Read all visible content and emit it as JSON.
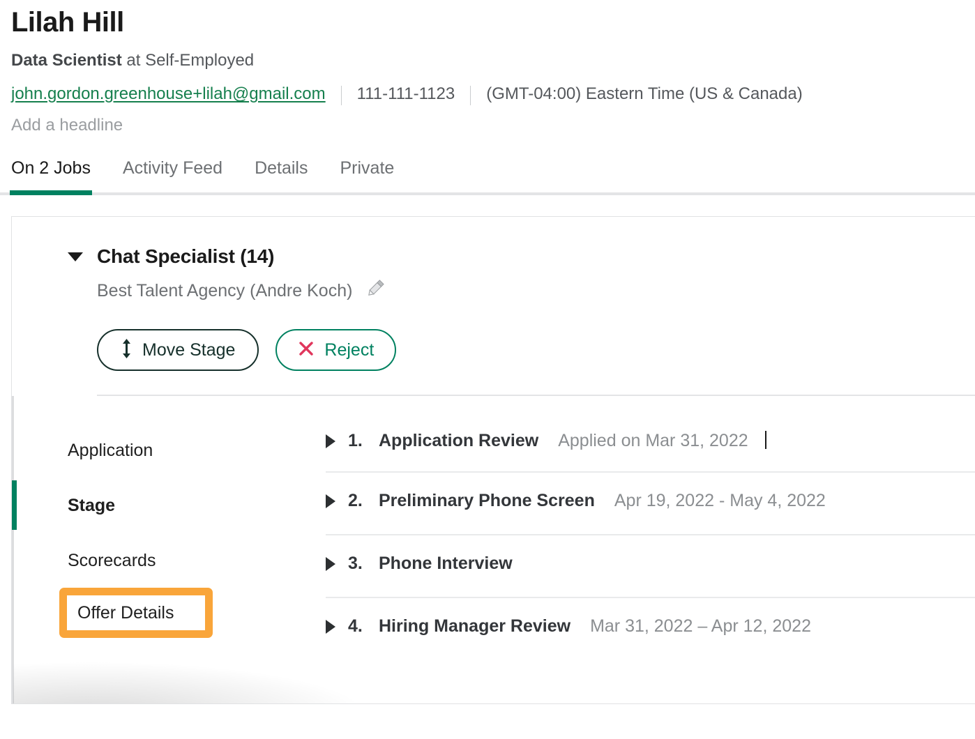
{
  "header": {
    "name": "Lilah Hill",
    "role": "Data Scientist",
    "company_prefix": " at ",
    "company": "Self-Employed",
    "email": "john.gordon.greenhouse+lilah@gmail.com",
    "phone": "111-111-1123",
    "timezone": "(GMT-04:00) Eastern Time (US & Canada)",
    "headline_placeholder": "Add a headline"
  },
  "tabs": [
    {
      "label": "On 2 Jobs",
      "active": true
    },
    {
      "label": "Activity Feed",
      "active": false
    },
    {
      "label": "Details",
      "active": false
    },
    {
      "label": "Private",
      "active": false
    }
  ],
  "job": {
    "title": "Chat Specialist (14)",
    "source": "Best Talent Agency (Andre Koch)",
    "edit_icon": "pencil-icon",
    "buttons": {
      "move_stage": "Move Stage",
      "move_stage_icon": "up-down-arrow-icon",
      "reject": "Reject",
      "reject_icon": "x-icon"
    }
  },
  "section_nav": [
    {
      "label": "Application",
      "active": false,
      "highlighted": false
    },
    {
      "label": "Stage",
      "active": true,
      "highlighted": false
    },
    {
      "label": "Scorecards",
      "active": false,
      "highlighted": false
    },
    {
      "label": "Offer Details",
      "active": false,
      "highlighted": true
    }
  ],
  "stages": [
    {
      "num": "1.",
      "name": "Application Review",
      "date": "Applied on Mar 31, 2022",
      "caret": true
    },
    {
      "num": "2.",
      "name": "Preliminary Phone Screen",
      "date": "Apr 19, 2022 - May 4, 2022",
      "caret": true
    },
    {
      "num": "3.",
      "name": "Phone Interview",
      "date": "",
      "caret": true
    },
    {
      "num": "4.",
      "name": "Hiring Manager Review",
      "date": "Mar 31, 2022 – Apr 12, 2022",
      "caret": true
    }
  ],
  "colors": {
    "brand_green": "#008160",
    "link_green": "#157f4d",
    "highlight_orange": "#f9a53a",
    "reject_red": "#e0365c",
    "divider_grey": "#e3e4e6",
    "muted_text": "#6d7073"
  }
}
